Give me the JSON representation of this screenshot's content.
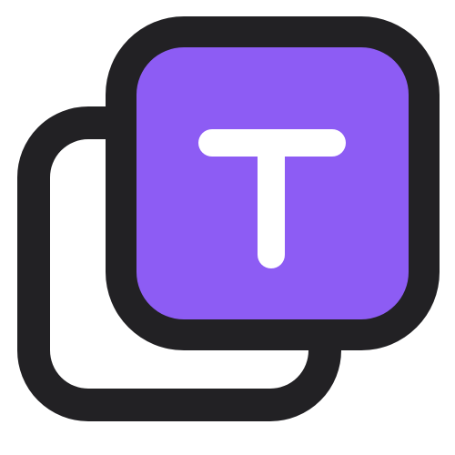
{
  "icon": {
    "name": "text-copy-icon",
    "glyph": "T",
    "colors": {
      "background": "#ffffff",
      "outline": "#222124",
      "fill": "#8d5cf4",
      "glyph": "#ffffff"
    }
  }
}
